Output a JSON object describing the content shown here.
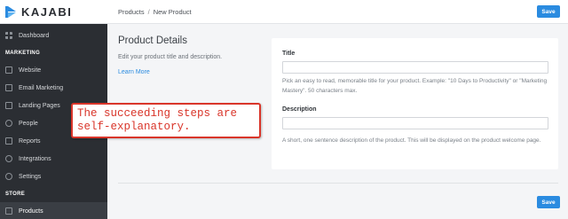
{
  "brand": {
    "name": "KAJABI"
  },
  "sidebar": {
    "dashboard": "Dashboard",
    "marketing_label": "MARKETING",
    "marketing_items": [
      "Website",
      "Email Marketing",
      "Landing Pages",
      "People",
      "Reports",
      "Integrations",
      "Settings"
    ],
    "store_label": "STORE",
    "products": "Products"
  },
  "topbar": {
    "crumb_root": "Products",
    "crumb_sep": "/",
    "crumb_current": "New Product",
    "save_label": "Save"
  },
  "details": {
    "heading": "Product Details",
    "description": "Edit your product title and description.",
    "learn_more": "Learn More"
  },
  "form": {
    "title_label": "Title",
    "title_value": "",
    "title_help": "Pick an easy to read, memorable title for your product. Example: \"10 Days to Productivity\" or \"Marketing Mastery\". 50 characters max.",
    "description_label": "Description",
    "description_value": "",
    "description_help": "A short, one sentence description of the product. This will be displayed on the product welcome page."
  },
  "footer": {
    "save_label": "Save"
  },
  "annotation": {
    "line1": "The succeeding steps are",
    "line2": "self-explanatory."
  },
  "colors": {
    "accent": "#2a8be0",
    "sidebar_bg": "#2b2e33",
    "annotation": "#d9352a"
  }
}
